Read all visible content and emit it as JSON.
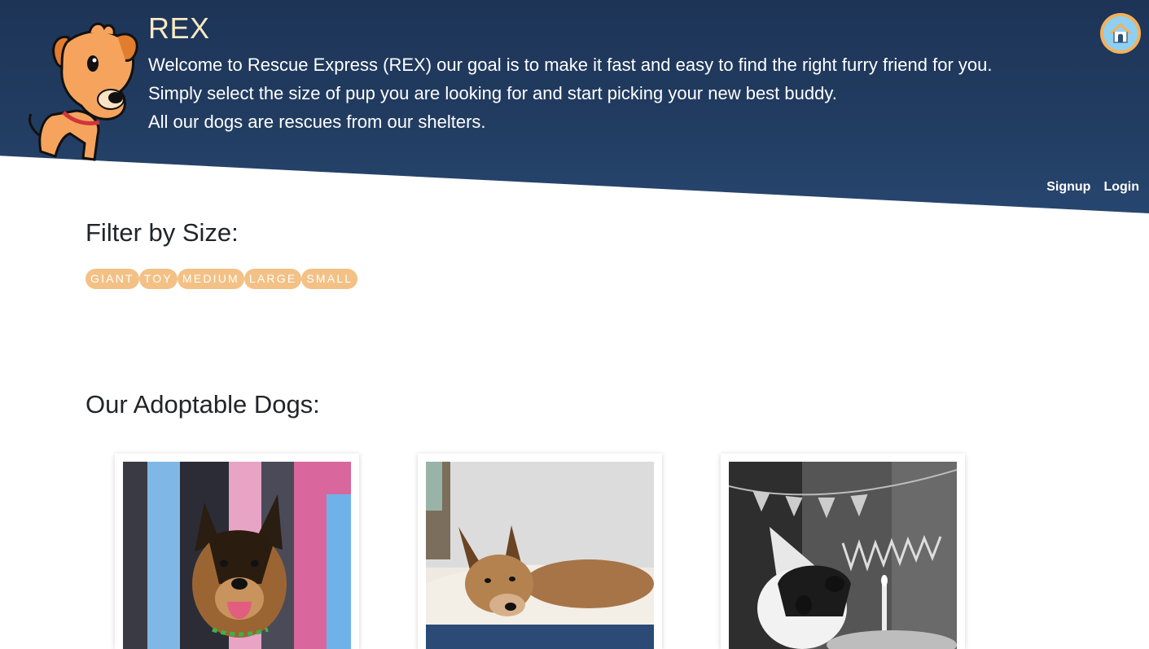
{
  "brand": {
    "title": "REX",
    "intro_lines": [
      "Welcome to Rescue Express (REX) our goal is to make it fast and easy to find the right furry friend for you.",
      "Simply select the size of pup you are looking for and start picking your new best buddy.",
      "All our dogs are rescues from our shelters."
    ]
  },
  "icons": {
    "home": "home-icon",
    "logo": "dog-logo"
  },
  "nav": {
    "signup": "Signup",
    "login": "Login"
  },
  "filter": {
    "heading": "Filter by Size:",
    "sizes": [
      "GIANT",
      "TOY",
      "MEDIUM",
      "LARGE",
      "SMALL"
    ]
  },
  "dogs": {
    "heading": "Our Adoptable Dogs:"
  },
  "colors": {
    "header": "#1d3457",
    "accent": "#f3c185",
    "title": "#f8e9c4"
  }
}
